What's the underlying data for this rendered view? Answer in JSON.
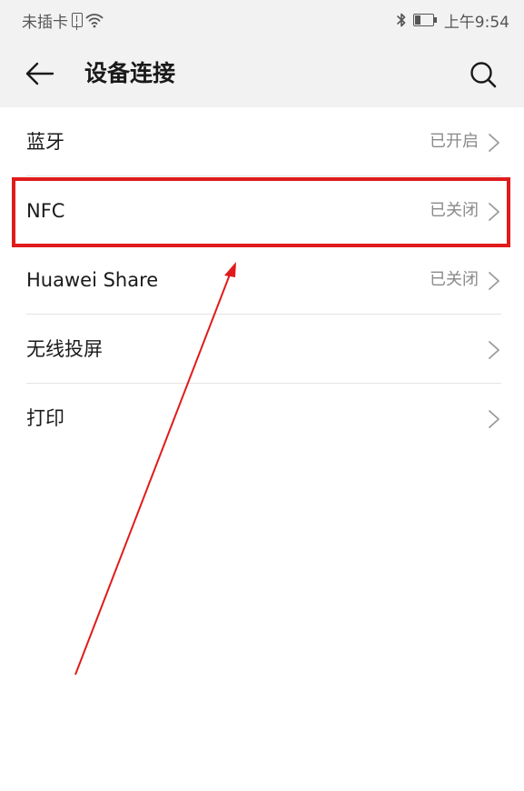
{
  "status_bar": {
    "carrier": "未插卡",
    "time": "上午9:54",
    "battery_level": 0.35,
    "icons": [
      "sim-icon",
      "wifi-icon",
      "bluetooth-icon",
      "battery-icon"
    ]
  },
  "app_bar": {
    "title": "设备连接",
    "back_icon": "arrow-left-icon",
    "search_icon": "search-icon"
  },
  "items": [
    {
      "label": "蓝牙",
      "status": "已开启"
    },
    {
      "label": "NFC",
      "status": "已关闭"
    },
    {
      "label": "Huawei Share",
      "status": "已关闭"
    },
    {
      "label": "无线投屏",
      "status": ""
    },
    {
      "label": "打印",
      "status": ""
    }
  ],
  "annotation": {
    "highlighted_item": "NFC",
    "color": "#e01b1b"
  }
}
